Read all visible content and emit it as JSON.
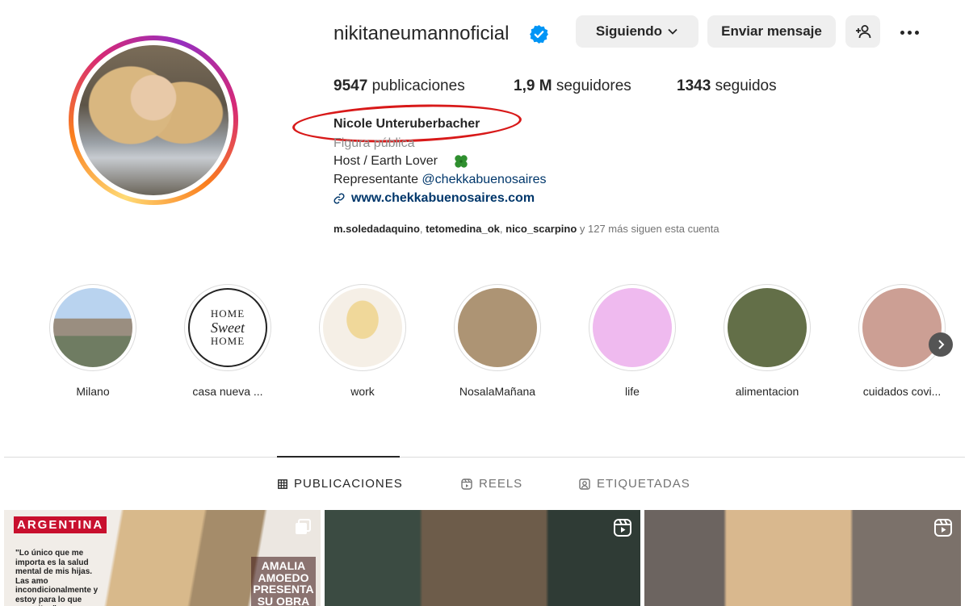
{
  "profile": {
    "username": "nikitaneumannoficial",
    "verified": true,
    "following_button": "Siguiendo",
    "message_button": "Enviar mensaje",
    "stats": {
      "posts_count": "9547",
      "posts_label": "publicaciones",
      "followers_count": "1,9 M",
      "followers_label": "seguidores",
      "following_count": "1343",
      "following_label": "seguidos"
    },
    "full_name": "Nicole Unteruberbacher",
    "category": "Figura pública",
    "bio_line1": "Host / Earth Lover",
    "bio_line2_prefix": "Representante",
    "bio_line2_mention": "@chekkabuenosaires",
    "website": "www.chekkabuenosaires.com",
    "followed_by": {
      "user1": "m.soledadaquino",
      "user2": "tetomedina_ok",
      "user3": "nico_scarpino",
      "sep": ", ",
      "suffix": " y 127 más siguen esta cuenta"
    }
  },
  "highlights": [
    {
      "label": "Milano",
      "color": "#8aa0b4"
    },
    {
      "label": "casa nueva ...",
      "color": "#ffffff"
    },
    {
      "label": "work",
      "color": "#f1e6d8"
    },
    {
      "label": "NosalaMañana",
      "color": "#ad9474"
    },
    {
      "label": "life",
      "color": "#efbaef"
    },
    {
      "label": "alimentacion",
      "color": "#636f48"
    },
    {
      "label": "cuidados covi...",
      "color": "#cc9f94"
    }
  ],
  "highlight_badge": {
    "line1": "HOME",
    "line2": "Sweet",
    "line3": "HOME"
  },
  "tabs": {
    "posts": "PUBLICACIONES",
    "reels": "REELS",
    "tagged": "ETIQUETADAS"
  },
  "posts": {
    "cover_brand": "ARGENTINA",
    "cover_quote": "\"Lo único que me importa es la salud mental de mis hijas. Las amo incondicionalmente y estoy para lo que necesiten\"",
    "cover_side": "AMALIA AMOEDO PRESENTA SU OBRA"
  },
  "colors": {
    "annotation_ellipse": "#d81919",
    "link": "#00376b",
    "verified": "#0095f6"
  }
}
